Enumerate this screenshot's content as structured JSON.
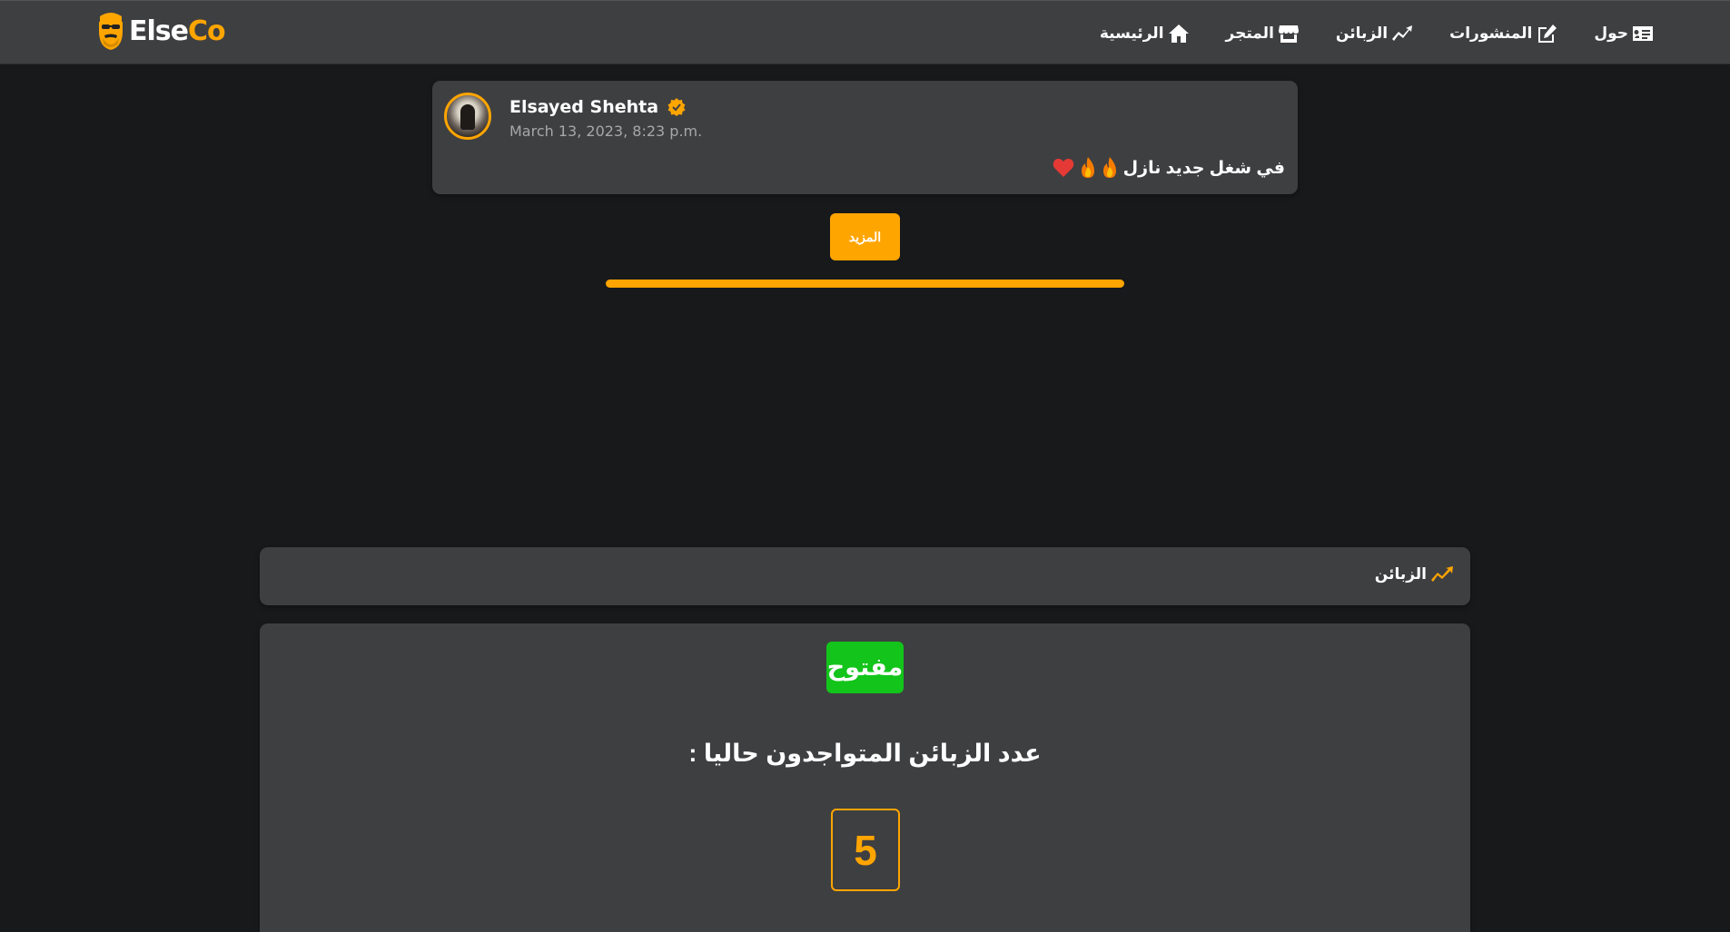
{
  "brand": {
    "name_part1": "Else",
    "name_part2": "Co"
  },
  "nav": {
    "items": [
      {
        "label": "الرئيسية",
        "icon": "home-icon"
      },
      {
        "label": "المتجر",
        "icon": "store-icon"
      },
      {
        "label": "الزبائن",
        "icon": "trend-up-icon"
      },
      {
        "label": "المنشورات",
        "icon": "edit-icon"
      },
      {
        "label": "حول",
        "icon": "id-card-icon"
      }
    ]
  },
  "post": {
    "author": "Elsayed Shehta",
    "verified": true,
    "date": "March 13, 2023, 8:23 p.m.",
    "text": "في شغل جديد نازل",
    "emojis": [
      "flame",
      "flame",
      "heart"
    ]
  },
  "more_button": {
    "label": "المزيد"
  },
  "customers_section": {
    "title": "الزبائن",
    "status": "مفتوح",
    "count_label": "عدد الزبائن المتواجدون حاليا :",
    "count": "5"
  },
  "colors": {
    "accent": "#ffa500",
    "navbar_bg": "#3e3f41",
    "page_bg": "#18191b",
    "status_open": "#13c41b",
    "heart": "#e53935"
  }
}
